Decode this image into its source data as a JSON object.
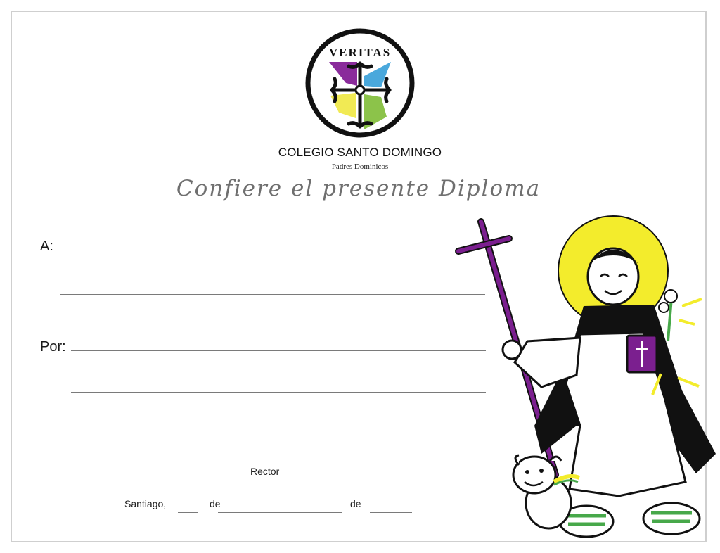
{
  "logo": {
    "motto": "VERITAS",
    "colors": {
      "purple": "#8a2b9b",
      "blue": "#4aa8dc",
      "yellow": "#f1ea54",
      "green": "#8cc34a"
    }
  },
  "school": {
    "name": "COLEGIO SANTO DOMINGO",
    "subtitle": "Padres Dominicos"
  },
  "heading": "Confiere el presente Diploma",
  "fields": {
    "to_label": "A:",
    "for_label": "Por:"
  },
  "signature": {
    "rector_label": "Rector"
  },
  "date_line": {
    "city": "Santiago,",
    "de1": "de",
    "de2": "de"
  },
  "illustration": {
    "subject": "santo-domingo-with-cross-book-dog",
    "colors": {
      "halo": "#f3ec2c",
      "cross": "#7b1f8f",
      "habit_black": "#111111",
      "sandals": "#47a84a",
      "book": "#7b1f8f"
    }
  }
}
